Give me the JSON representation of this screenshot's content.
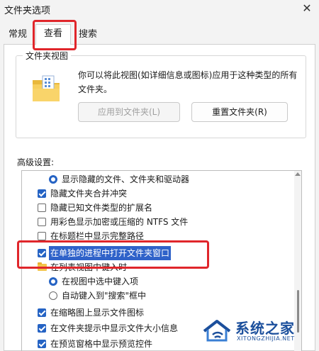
{
  "window": {
    "title": "文件夹选项",
    "close_glyph": "✕"
  },
  "tabs": [
    {
      "label": "常规",
      "selected": false
    },
    {
      "label": "查看",
      "selected": true
    },
    {
      "label": "搜索",
      "selected": false
    }
  ],
  "folder_views": {
    "group_title": "文件夹视图",
    "description": "你可以将此视图(如详细信息或图标)应用于这种类型的所有文件夹。",
    "apply_button": "应用到文件夹(L)",
    "reset_button": "重置文件夹(R)"
  },
  "advanced": {
    "label": "高级设置:",
    "items": [
      {
        "type": "radio",
        "checked": true,
        "label": "显示隐藏的文件、文件夹和驱动器"
      },
      {
        "type": "checkbox",
        "checked": true,
        "label": "隐藏文件夹合并冲突"
      },
      {
        "type": "checkbox",
        "checked": false,
        "label": "隐藏已知文件类型的扩展名"
      },
      {
        "type": "checkbox",
        "checked": false,
        "label": "用彩色显示加密或压缩的 NTFS 文件"
      },
      {
        "type": "checkbox",
        "checked": false,
        "label": "在标题栏中显示完整路径"
      },
      {
        "type": "checkbox",
        "checked": true,
        "label": "在单独的进程中打开文件夹窗口",
        "selected": true
      },
      {
        "type": "folder",
        "label": "在列表视图中键入时"
      },
      {
        "type": "radio",
        "checked": true,
        "label": "在视图中选中键入项"
      },
      {
        "type": "radio",
        "checked": false,
        "label": "自动键入到\"搜索\"框中"
      },
      {
        "type": "checkbox",
        "checked": true,
        "label": "在缩略图上显示文件图标"
      },
      {
        "type": "checkbox",
        "checked": true,
        "label": "在文件夹提示中显示文件大小信息"
      },
      {
        "type": "checkbox",
        "checked": true,
        "label": "在预览窗格中显示预览控件"
      }
    ]
  },
  "watermark": {
    "name": "系统之家",
    "url": "XITONGZHIJIA.NET"
  },
  "colors": {
    "accent": "#2563c4",
    "highlight": "#e0262b"
  }
}
